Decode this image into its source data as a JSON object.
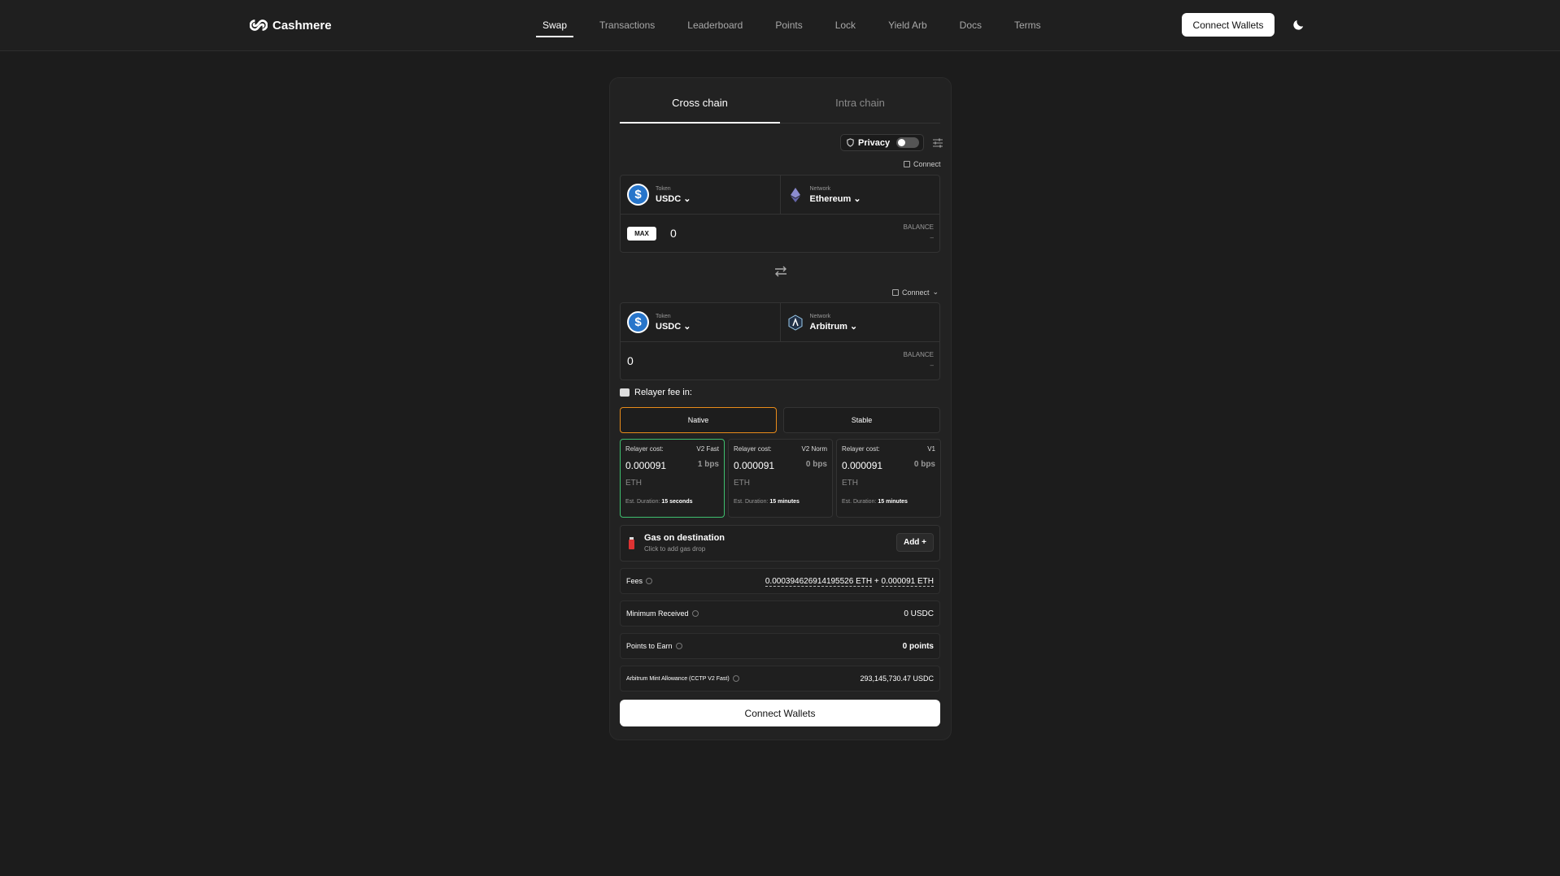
{
  "brand": {
    "name": "Cashmere"
  },
  "nav": {
    "items": [
      "Swap",
      "Transactions",
      "Leaderboard",
      "Points",
      "Lock",
      "Yield Arb",
      "Docs",
      "Terms"
    ],
    "active": "Swap"
  },
  "header": {
    "connect_label": "Connect Wallets",
    "theme_icon": "moon-icon"
  },
  "tabs": {
    "cross": "Cross chain",
    "intra": "Intra chain"
  },
  "privacy": {
    "label": "Privacy",
    "enabled": false
  },
  "from": {
    "connect_label": "Connect",
    "token_label": "Token",
    "token": "USDC",
    "network_label": "Network",
    "network": "Ethereum",
    "max_label": "MAX",
    "amount": "0",
    "balance_label": "BALANCE",
    "balance": "–"
  },
  "to": {
    "connect_label": "Connect",
    "token_label": "Token",
    "token": "USDC",
    "network_label": "Network",
    "network": "Arbitrum",
    "amount": "0",
    "balance_label": "BALANCE",
    "balance": "–"
  },
  "relayer": {
    "title": "Relayer fee in:",
    "options": [
      "Native",
      "Stable"
    ],
    "selected": "Native",
    "plans": [
      {
        "label": "Relayer cost:",
        "tier": "V2 Fast",
        "cost": "0.000091",
        "bps": "1 bps",
        "currency": "ETH",
        "duration_label": "Est. Duration:",
        "duration": "15 seconds"
      },
      {
        "label": "Relayer cost:",
        "tier": "V2 Norm",
        "cost": "0.000091",
        "bps": "0 bps",
        "currency": "ETH",
        "duration_label": "Est. Duration:",
        "duration": "15 minutes"
      },
      {
        "label": "Relayer cost:",
        "tier": "V1",
        "cost": "0.000091",
        "bps": "0 bps",
        "currency": "ETH",
        "duration_label": "Est. Duration:",
        "duration": "15 minutes"
      }
    ]
  },
  "gas": {
    "title": "Gas on destination",
    "subtitle": "Click to add gas drop",
    "add_label": "Add +"
  },
  "summary": {
    "fees_label": "Fees",
    "fees_a": "0.000394626914195526 ETH",
    "fees_plus": "+",
    "fees_b": "0.000091 ETH",
    "min_label": "Minimum Received",
    "min_value": "0 USDC",
    "points_label": "Points to Earn",
    "points_value": "0 points",
    "allowance_label": "Arbitrum Mint Allowance (CCTP V2 Fast)",
    "allowance_value": "293,145,730.47 USDC"
  },
  "main_button": "Connect Wallets",
  "colors": {
    "selected_option": "#e88b1a",
    "selected_plan": "#3fbf6f",
    "usdc": "#2775ca"
  }
}
